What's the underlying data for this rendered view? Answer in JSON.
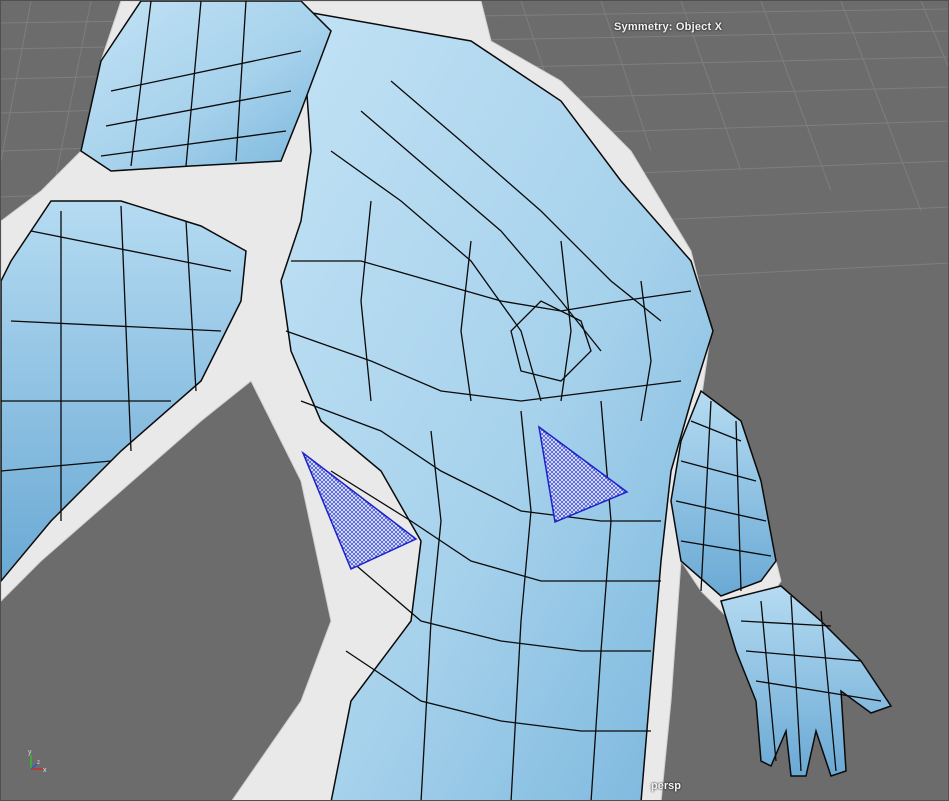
{
  "viewport": {
    "camera_label": "persp",
    "symmetry_label": "Symmetry: Object X",
    "axis": {
      "y_label": "y",
      "x_label": "x",
      "z_label": "z"
    }
  },
  "colors": {
    "background": "#6c6c6c",
    "grid": "#7c7c7c",
    "mesh_fill": "#a9d3ec",
    "mesh_fill_dark": "#7fb8dc",
    "skin_white": "#e8e8e8",
    "wire": "#0a0a0a",
    "selected_face": "#1d22c8"
  },
  "icons": [
    "axis-gizmo-icon"
  ]
}
